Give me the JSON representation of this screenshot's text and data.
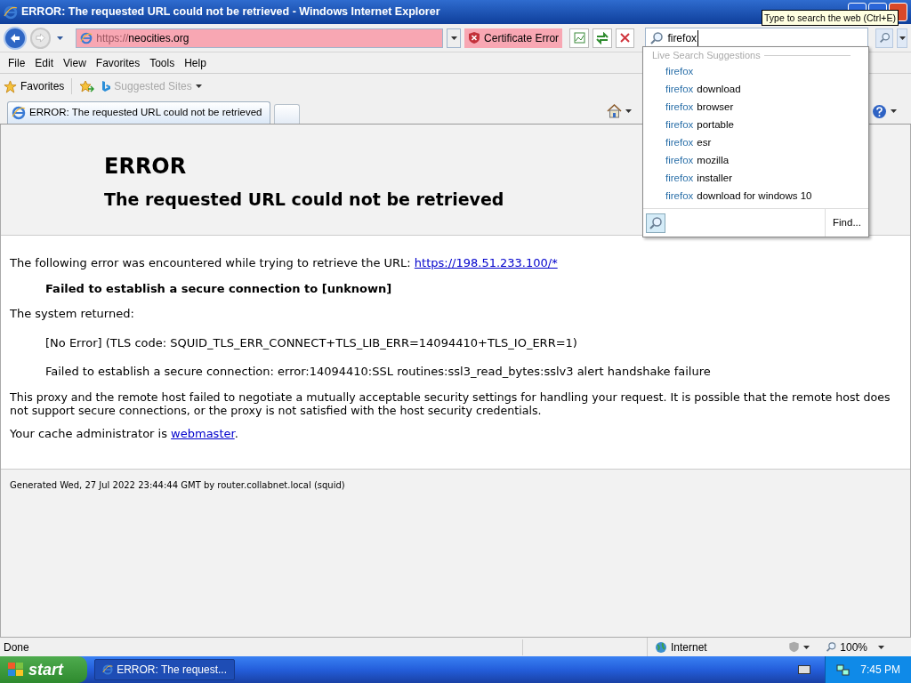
{
  "window": {
    "title": "ERROR: The requested URL could not be retrieved - Windows Internet Explorer"
  },
  "address_bar": {
    "scheme": "https://",
    "host": "neocities.org",
    "certificate_error": "Certificate Error"
  },
  "search": {
    "value": "firefox",
    "tooltip": "Type to search the web (Ctrl+E)",
    "suggestions_heading": "Live Search Suggestions",
    "find_label": "Find...",
    "suggestions": [
      {
        "match": "firefox"
      },
      {
        "match": "firefox",
        "rest": "download"
      },
      {
        "match": "firefox",
        "rest": "browser"
      },
      {
        "match": "firefox",
        "rest": "portable"
      },
      {
        "match": "firefox",
        "rest": "esr"
      },
      {
        "match": "firefox",
        "rest": "mozilla"
      },
      {
        "match": "firefox",
        "rest": "installer"
      },
      {
        "match": "firefox",
        "rest": "download for windows 10"
      }
    ]
  },
  "menu": [
    "File",
    "Edit",
    "View",
    "Favorites",
    "Tools",
    "Help"
  ],
  "favorites_bar": {
    "favorites": "Favorites",
    "suggested_sites": "Suggested Sites"
  },
  "tabs": [
    {
      "label": "ERROR: The requested URL could not be retrieved",
      "selected": true
    }
  ],
  "page": {
    "heading": "ERROR",
    "subheading": "The requested URL could not be retrieved",
    "intro": "The following error was encountered while trying to retrieve the URL:",
    "intro_link": "https://198.51.233.100/*",
    "error_message": "Failed to establish a secure connection to [unknown]",
    "system_returned": "The system returned:",
    "details": [
      "[No Error] (TLS code: SQUID_TLS_ERR_CONNECT+TLS_LIB_ERR=14094410+TLS_IO_ERR=1)",
      "Failed to establish a secure connection: error:14094410:SSL routines:ssl3_read_bytes:sslv3 alert handshake failure"
    ],
    "explanation": "This proxy and the remote host failed to negotiate a mutually acceptable security settings for handling your request. It is possible that the remote host does not support secure connections, or the proxy is not satisfied with the host security credentials.",
    "admin_text": "Your cache administrator is",
    "admin_link": "webmaster",
    "admin_suffix": ".",
    "footer": "Generated Wed, 27 Jul 2022 23:44:44 GMT by router.collabnet.local (squid)"
  },
  "status_bar": {
    "status": "Done",
    "zone": "Internet",
    "zoom": "100%"
  },
  "taskbar": {
    "start": "start",
    "window": "ERROR: The request...",
    "clock": "7:45 PM"
  }
}
